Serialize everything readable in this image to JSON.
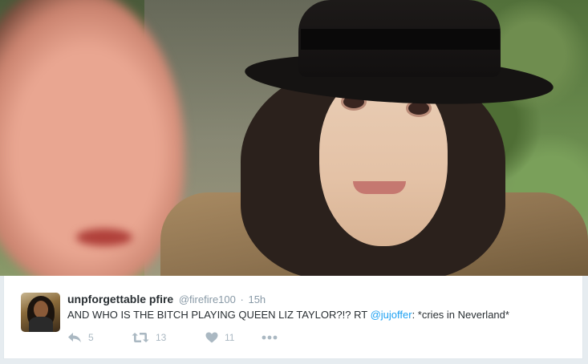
{
  "tweet": {
    "display_name": "unpforgettable pfire",
    "handle": "@firefire100",
    "separator": "·",
    "time": "15h",
    "text_before": "AND WHO IS THE BITCH PLAYING QUEEN LIZ TAYLOR?!? RT ",
    "mention": "@jujoffer",
    "text_after": ": *cries in Neverland*",
    "reply_count": "5",
    "retweet_count": "13",
    "like_count": "11",
    "more_label": "•••"
  },
  "icons": {
    "reply": "reply-icon",
    "retweet": "retweet-icon",
    "like": "heart-icon",
    "more": "more-icon"
  },
  "colors": {
    "name": "#292f33",
    "meta": "#8899a6",
    "link": "#1da1f2",
    "action": "#aab8c2",
    "background": "#e6ecf0"
  }
}
